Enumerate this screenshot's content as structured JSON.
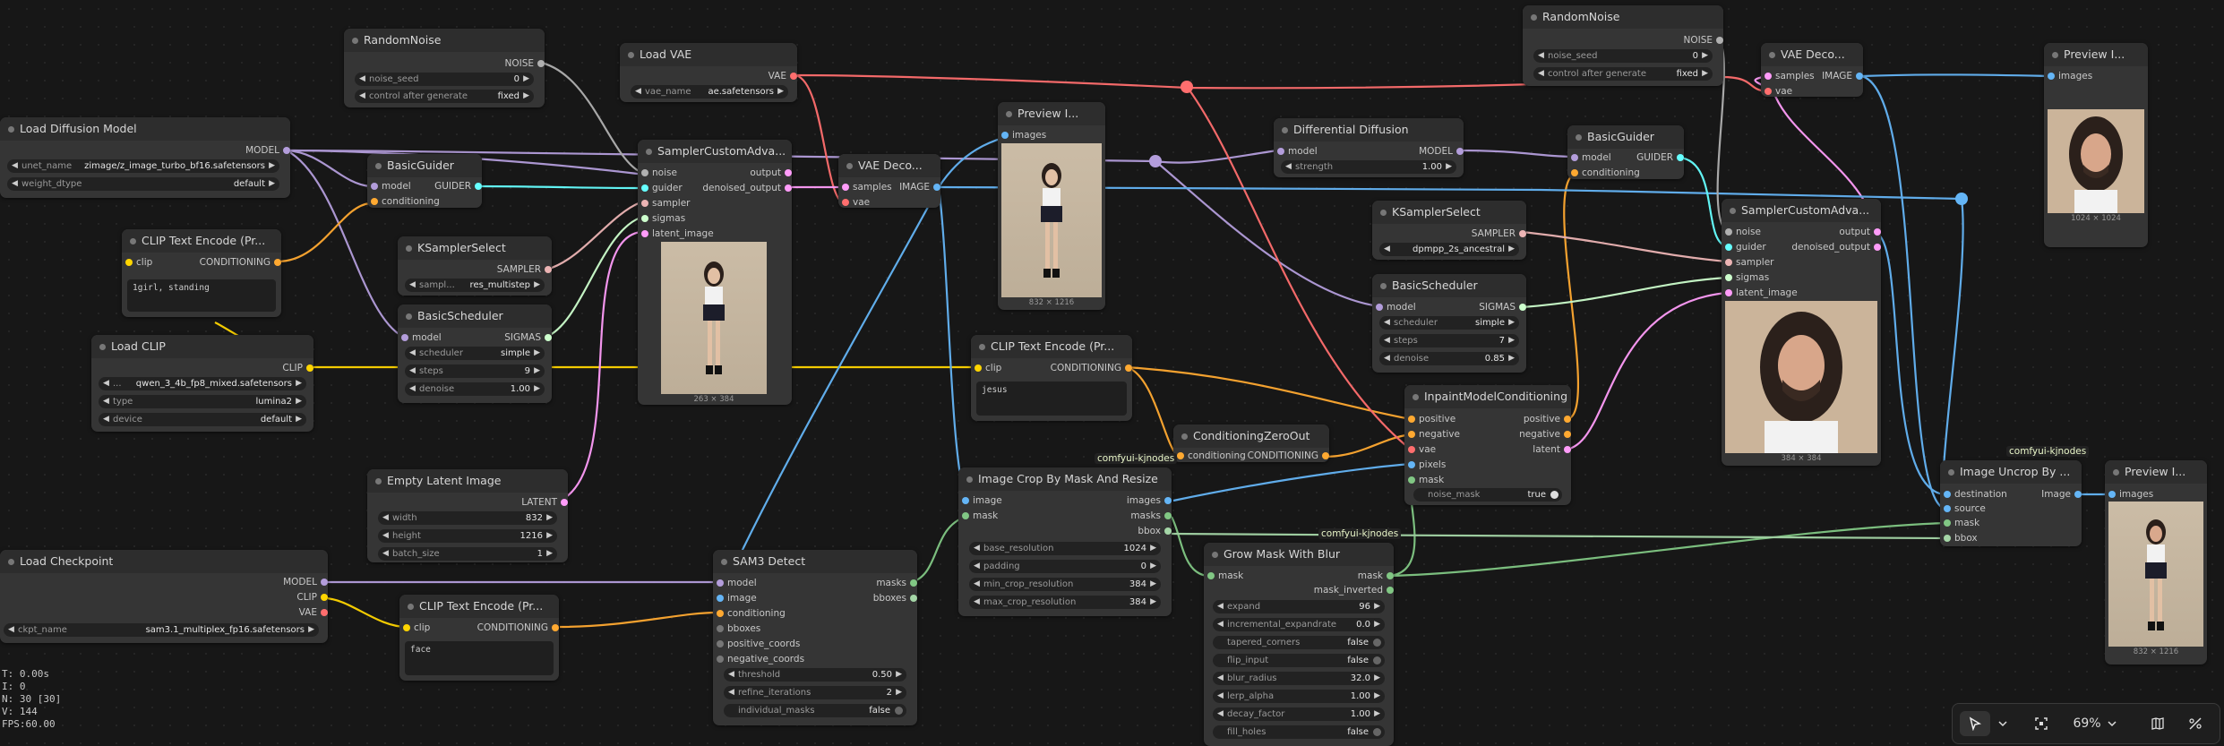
{
  "colors": {
    "model": "#b39ddb",
    "clip": "#ffd500",
    "conditioning": "#ffa931",
    "vae": "#ff6e6e",
    "latent": "#ff9cf9",
    "image": "#64b5f6",
    "mask": "#81c784",
    "sampler": "#ecb4b4",
    "sigmas": "#cdffcd",
    "guider": "#66ffff",
    "noise": "#b0b0b0",
    "bbox": "#a5d6a7"
  },
  "nodes": {
    "random_noise_1": {
      "title": "RandomNoise",
      "out_noise": "NOISE",
      "noise_seed": {
        "label": "noise_seed",
        "value": "0"
      },
      "control": {
        "label": "control after generate",
        "value": "fixed"
      }
    },
    "load_vae": {
      "title": "Load VAE",
      "out_vae": "VAE",
      "vae_name": {
        "label": "vae_name",
        "value": "ae.safetensors"
      }
    },
    "load_diffusion": {
      "title": "Load Diffusion Model",
      "out_model": "MODEL",
      "unet_name": {
        "label": "unet_name",
        "value": "zimage/z_image_turbo_bf16.safetensors"
      },
      "weight_dtype": {
        "label": "weight_dtype",
        "value": "default"
      }
    },
    "basic_guider_1": {
      "title": "BasicGuider",
      "in_model": "model",
      "in_conditioning": "conditioning",
      "out_guider": "GUIDER"
    },
    "clip_text_1": {
      "title": "CLIP Text Encode (Pr...",
      "in_clip": "clip",
      "out_conditioning": "CONDITIONING",
      "text": "1girl, standing"
    },
    "ksampler_select_1": {
      "title": "KSamplerSelect",
      "out_sampler": "SAMPLER",
      "sampler_name": {
        "label": "sampl...",
        "value": "res_multistep"
      }
    },
    "basic_scheduler_1": {
      "title": "BasicScheduler",
      "in_model": "model",
      "out_sigmas": "SIGMAS",
      "scheduler": {
        "label": "scheduler",
        "value": "simple"
      },
      "steps": {
        "label": "steps",
        "value": "9"
      },
      "denoise": {
        "label": "denoise",
        "value": "1.00"
      }
    },
    "load_clip": {
      "title": "Load CLIP",
      "out_clip": "CLIP",
      "clip_name": {
        "label": "...",
        "value": "qwen_3_4b_fp8_mixed.safetensors"
      },
      "type": {
        "label": "type",
        "value": "lumina2"
      },
      "device": {
        "label": "device",
        "value": "default"
      }
    },
    "sampler_custom_1": {
      "title": "SamplerCustomAdva...",
      "in_noise": "noise",
      "in_guider": "guider",
      "in_sampler": "sampler",
      "in_sigmas": "sigmas",
      "in_latent": "latent_image",
      "out_output": "output",
      "out_denoised": "denoised_output",
      "caption": "263 × 384"
    },
    "vae_decode_1": {
      "title": "VAE Deco...",
      "in_samples": "samples",
      "in_vae": "vae",
      "out_image": "IMAGE"
    },
    "preview_1": {
      "title": "Preview I...",
      "in_images": "images",
      "caption": "832 × 1216"
    },
    "differential_diffusion": {
      "title": "Differential Diffusion",
      "in_model": "model",
      "out_model": "MODEL",
      "strength": {
        "label": "strength",
        "value": "1.00"
      }
    },
    "random_noise_2": {
      "title": "RandomNoise",
      "out_noise": "NOISE",
      "noise_seed": {
        "label": "noise_seed",
        "value": "0"
      },
      "control": {
        "label": "control after generate",
        "value": "fixed"
      }
    },
    "basic_guider_2": {
      "title": "BasicGuider",
      "in_model": "model",
      "in_conditioning": "conditioning",
      "out_guider": "GUIDER"
    },
    "vae_decode_2": {
      "title": "VAE Deco...",
      "in_samples": "samples",
      "in_vae": "vae",
      "out_image": "IMAGE"
    },
    "preview_2": {
      "title": "Preview I...",
      "in_images": "images",
      "caption": "1024 × 1024"
    },
    "ksampler_select_2": {
      "title": "KSamplerSelect",
      "out_sampler": "SAMPLER",
      "sampler_name": {
        "label": "",
        "value": "dpmpp_2s_ancestral"
      }
    },
    "basic_scheduler_2": {
      "title": "BasicScheduler",
      "in_model": "model",
      "out_sigmas": "SIGMAS",
      "scheduler": {
        "label": "scheduler",
        "value": "simple"
      },
      "steps": {
        "label": "steps",
        "value": "7"
      },
      "denoise": {
        "label": "denoise",
        "value": "0.85"
      }
    },
    "sampler_custom_2": {
      "title": "SamplerCustomAdva...",
      "in_noise": "noise",
      "in_guider": "guider",
      "in_sampler": "sampler",
      "in_sigmas": "sigmas",
      "in_latent": "latent_image",
      "out_output": "output",
      "out_denoised": "denoised_output",
      "caption": "384 × 384"
    },
    "clip_text_2": {
      "title": "CLIP Text Encode (Pr...",
      "in_clip": "clip",
      "out_conditioning": "CONDITIONING",
      "text": "jesus"
    },
    "conditioning_zero": {
      "title": "ConditioningZeroOut",
      "in_conditioning": "conditioning",
      "out_conditioning": "CONDITIONING"
    },
    "inpaint_model_cond": {
      "title": "InpaintModelConditioning",
      "in_positive": "positive",
      "in_negative": "negative",
      "in_vae": "vae",
      "in_pixels": "pixels",
      "in_mask": "mask",
      "out_positive": "positive",
      "out_negative": "negative",
      "out_latent": "latent",
      "noise_mask": {
        "label": "noise_mask",
        "value": "true"
      }
    },
    "empty_latent": {
      "title": "Empty Latent Image",
      "out_latent": "LATENT",
      "width": {
        "label": "width",
        "value": "832"
      },
      "height": {
        "label": "height",
        "value": "1216"
      },
      "batch_size": {
        "label": "batch_size",
        "value": "1"
      }
    },
    "image_crop": {
      "title": "Image Crop By Mask And Resize",
      "badge": "comfyui-kjnodes",
      "in_image": "image",
      "in_mask": "mask",
      "out_images": "images",
      "out_masks": "masks",
      "out_bbox": "bbox",
      "base_resolution": {
        "label": "base_resolution",
        "value": "1024"
      },
      "padding": {
        "label": "padding",
        "value": "0"
      },
      "min_crop_resolution": {
        "label": "min_crop_resolution",
        "value": "384"
      },
      "max_crop_resolution": {
        "label": "max_crop_resolution",
        "value": "384"
      }
    },
    "grow_mask": {
      "title": "Grow Mask With Blur",
      "badge": "comfyui-kjnodes",
      "in_mask": "mask",
      "out_mask": "mask",
      "out_mask_inverted": "mask_inverted",
      "expand": {
        "label": "expand",
        "value": "96"
      },
      "incremental_expandrate": {
        "label": "incremental_expandrate",
        "value": "0.0"
      },
      "tapered_corners": {
        "label": "tapered_corners",
        "value": "false"
      },
      "flip_input": {
        "label": "flip_input",
        "value": "false"
      },
      "blur_radius": {
        "label": "blur_radius",
        "value": "32.0"
      },
      "lerp_alpha": {
        "label": "lerp_alpha",
        "value": "1.00"
      },
      "decay_factor": {
        "label": "decay_factor",
        "value": "1.00"
      },
      "fill_holes": {
        "label": "fill_holes",
        "value": "false"
      }
    },
    "image_uncrop": {
      "title": "Image Uncrop By ...",
      "badge": "comfyui-kjnodes",
      "in_destination": "destination",
      "in_source": "source",
      "in_mask": "mask",
      "in_bbox": "bbox",
      "out_image": "Image"
    },
    "preview_3": {
      "title": "Preview I...",
      "in_images": "images",
      "caption": "832 × 1216"
    },
    "load_checkpoint": {
      "title": "Load Checkpoint",
      "out_model": "MODEL",
      "out_clip": "CLIP",
      "out_vae": "VAE",
      "ckpt_name": {
        "label": "ckpt_name",
        "value": "sam3.1_multiplex_fp16.safetensors"
      }
    },
    "clip_text_3": {
      "title": "CLIP Text Encode (Pr...",
      "in_clip": "clip",
      "out_conditioning": "CONDITIONING",
      "text": "face"
    },
    "sam3_detect": {
      "title": "SAM3 Detect",
      "in_model": "model",
      "in_image": "image",
      "in_conditioning": "conditioning",
      "in_bboxes": "bboxes",
      "in_positive": "positive_coords",
      "in_negative": "negative_coords",
      "out_masks": "masks",
      "out_bboxes": "bboxes",
      "threshold": {
        "label": "threshold",
        "value": "0.50"
      },
      "refine_iterations": {
        "label": "refine_iterations",
        "value": "2"
      },
      "individual_masks": {
        "label": "individual_masks",
        "value": "false"
      }
    }
  },
  "stats": {
    "t": "T: 0.00s",
    "i": "I: 0",
    "n": "N: 30 [30]",
    "v": "V: 144",
    "fps": "FPS:60.00"
  },
  "toolbar": {
    "select_icon": "pointer-icon",
    "fit_icon": "fit-view-icon",
    "zoom": "69%",
    "map_icon": "minimap-icon",
    "link_icon": "link-visibility-icon"
  }
}
